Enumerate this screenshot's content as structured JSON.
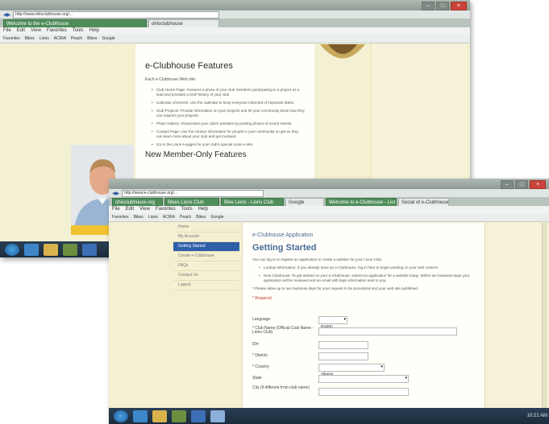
{
  "back_window": {
    "url": "http://www.ohioclubhouse.org/...",
    "tabs": [
      "Welcome to the e-Clubhouse",
      "ohioclubhouse"
    ],
    "menu": [
      "File",
      "Edit",
      "View",
      "Favorites",
      "Tools",
      "Help"
    ],
    "favorites": [
      "Favorites",
      "Bikes",
      "Lions",
      "ACIRA",
      "Peach",
      "Bikes",
      "Google"
    ],
    "heading": "e-Clubhouse Features",
    "intro": "Each e-Clubhouse Web site:",
    "bullets": [
      "Club Home Page: Features a photo of your club members participating in a project as a lead and provides a brief history of your club.",
      "Calendar of Events: Use the calendar to keep everyone informed of important dates.",
      "Club Projects: Provide information on your projects and let your community know how they can support your projects.",
      "Photo Gallery: Showcases your club's activities by posting photos of recent events.",
      "Contact Page: Use the contact information for people in your community so get so they can learn more about your club and get involved.",
      "Go to the Lions e-pages for your club's special Lions e-site."
    ],
    "heading2": "New Member-Only Features"
  },
  "front_window": {
    "url": "http://www.e-clubhouse.org/...",
    "tabs": [
      "ohioclubhouse.org",
      "Bikes Lions Club",
      "Bike Lions - Lions Club",
      "Google",
      "Welcome to e-Clubhouse - Lions Club",
      "Social of e-Clubhouse"
    ],
    "menu": [
      "File",
      "Edit",
      "View",
      "Favorites",
      "Tools",
      "Help"
    ],
    "favorites": [
      "Favorites",
      "Bikes",
      "Lions",
      "ACIRA",
      "Peach",
      "Bikes",
      "Google"
    ],
    "nav": [
      "Home",
      "My Account",
      "Getting Started",
      "Create e-Clubhouse",
      "FAQs",
      "Contact Us",
      "Logout"
    ],
    "nav_active_index": 2,
    "app_title": "e-Clubhouse Application",
    "section_title": "Getting Started",
    "intro": "You can log in or register an application to create a website for your Lions Club.",
    "bullets": [
      "Lookup Information: If you already have an e-Clubhouse, log in here to begin working on your web content.",
      "New Clubhouse: To get started on your e-Clubhouse, submit an application for a website today. Within ten business days your application will be reviewed and an email with login information sent to you."
    ],
    "note": "* Please allow up to two business days for your request to be processed and your web site published.",
    "required_label": "* Required",
    "fields": [
      {
        "label": "Language",
        "value": "English",
        "type": "select"
      },
      {
        "label": "* Club Name (Official Club Name - Lions Club)",
        "value": "",
        "type": "text"
      },
      {
        "label": "ID#",
        "value": "",
        "type": "text"
      },
      {
        "label": "* District",
        "value": "",
        "type": "text"
      },
      {
        "label": "* Country",
        "value": "Albania",
        "type": "select"
      },
      {
        "label": "State",
        "value": "",
        "type": "select"
      },
      {
        "label": "City (if different from club name)",
        "value": "",
        "type": "text"
      }
    ]
  },
  "colors": {
    "beige": "#f4f0d2",
    "nav_active": "#2f5fa8",
    "required": "#c0392b",
    "heading_blue": "#4a6a9a"
  },
  "icons": [
    "windows-start-icon",
    "ie-icon",
    "folder-icon",
    "media-icon",
    "network-icon"
  ],
  "clock": "10:21 AM"
}
